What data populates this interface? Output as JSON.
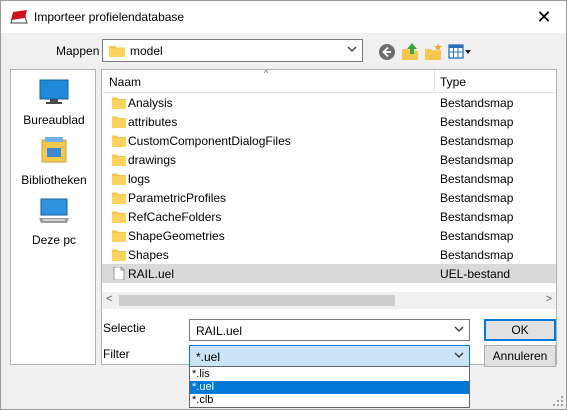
{
  "window": {
    "title": "Importeer profielendatabase",
    "close_glyph": "✕"
  },
  "location": {
    "label": "Mappen",
    "value": "model"
  },
  "toolbar": [
    "back-icon",
    "up-folder-icon",
    "new-folder-icon",
    "view-menu-icon"
  ],
  "places": [
    {
      "label": "Bureaublad",
      "icon": "desktop-icon"
    },
    {
      "label": "Bibliotheken",
      "icon": "libraries-icon"
    },
    {
      "label": "Deze pc",
      "icon": "this-pc-icon"
    }
  ],
  "list": {
    "col_name": "Naam",
    "col_type": "Type",
    "rows": [
      {
        "name": "Analysis",
        "type": "Bestandsmap",
        "kind": "folder"
      },
      {
        "name": "attributes",
        "type": "Bestandsmap",
        "kind": "folder"
      },
      {
        "name": "CustomComponentDialogFiles",
        "type": "Bestandsmap",
        "kind": "folder"
      },
      {
        "name": "drawings",
        "type": "Bestandsmap",
        "kind": "folder"
      },
      {
        "name": "logs",
        "type": "Bestandsmap",
        "kind": "folder"
      },
      {
        "name": "ParametricProfiles",
        "type": "Bestandsmap",
        "kind": "folder"
      },
      {
        "name": "RefCacheFolders",
        "type": "Bestandsmap",
        "kind": "folder"
      },
      {
        "name": "ShapeGeometries",
        "type": "Bestandsmap",
        "kind": "folder"
      },
      {
        "name": "Shapes",
        "type": "Bestandsmap",
        "kind": "folder"
      },
      {
        "name": "RAIL.uel",
        "type": "UEL-bestand",
        "kind": "file",
        "selected": true
      }
    ]
  },
  "selection": {
    "label": "Selectie",
    "value": "RAIL.uel"
  },
  "filter": {
    "label": "Filter",
    "value": "*.uel",
    "options": [
      "*.lis",
      "*.uel",
      "*.clb"
    ],
    "highlighted": "*.uel"
  },
  "buttons": {
    "ok": "OK",
    "cancel": "Annuleren"
  },
  "colors": {
    "accent": "#0078d7",
    "folder": "#f4c74e",
    "selected_row": "#d9d9d9"
  }
}
